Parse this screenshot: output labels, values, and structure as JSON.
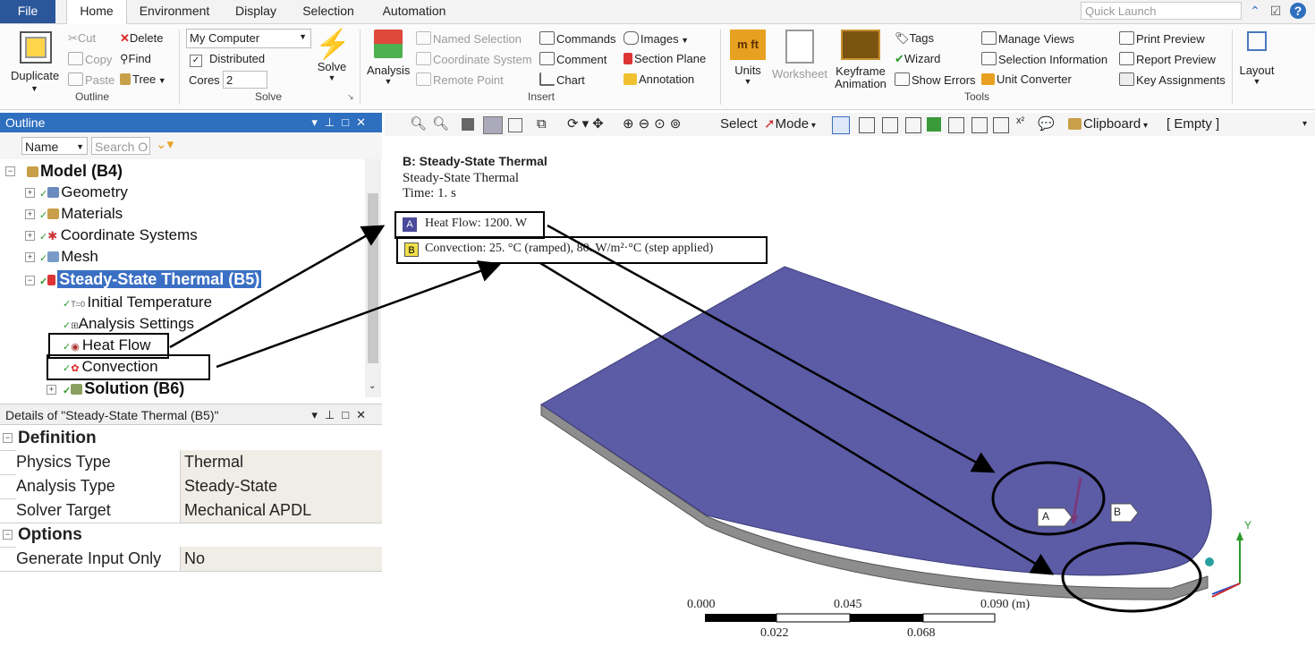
{
  "tabs": [
    "File",
    "Home",
    "Environment",
    "Display",
    "Selection",
    "Automation"
  ],
  "quick_launch": {
    "placeholder": "Quick Launch"
  },
  "ribbon": {
    "outline": {
      "label": "Outline",
      "duplicate": "Duplicate",
      "cut": "Cut",
      "copy": "Copy",
      "paste": "Paste",
      "delete": "Delete",
      "find": "Find",
      "tree": "Tree"
    },
    "solve": {
      "label": "Solve",
      "computer": "My Computer",
      "distributed": "Distributed",
      "cores_label": "Cores",
      "cores_value": "2",
      "solve_button": "Solve"
    },
    "insert": {
      "label": "Insert",
      "analysis": "Analysis",
      "named_selection": "Named Selection",
      "coordinate_system": "Coordinate System",
      "remote_point": "Remote Point",
      "commands": "Commands",
      "comment": "Comment",
      "chart": "Chart",
      "images": "Images",
      "section_plane": "Section Plane",
      "annotation": "Annotation"
    },
    "tools": {
      "label": "Tools",
      "units": "Units",
      "units_icon": "m ft",
      "worksheet": "Worksheet",
      "keyframe": "Keyframe",
      "animation": "Animation",
      "tags": "Tags",
      "wizard": "Wizard",
      "show_errors": "Show Errors",
      "manage_views": "Manage Views",
      "selection_information": "Selection Information",
      "unit_converter": "Unit Converter",
      "print_preview": "Print Preview",
      "report_preview": "Report Preview",
      "key_assignments": "Key Assignments"
    },
    "layout": "Layout"
  },
  "outline_panel": {
    "title": "Outline",
    "name_filter": "Name",
    "search_placeholder": "Search O",
    "items": [
      {
        "label": "Model (B4)"
      },
      {
        "label": "Geometry"
      },
      {
        "label": "Materials"
      },
      {
        "label": "Coordinate Systems"
      },
      {
        "label": "Mesh"
      },
      {
        "label": "Steady-State Thermal (B5)"
      },
      {
        "label": "Initial Temperature"
      },
      {
        "label": "Analysis Settings"
      },
      {
        "label": "Heat Flow"
      },
      {
        "label": "Convection"
      },
      {
        "label": "Solution (B6)"
      }
    ]
  },
  "details_panel": {
    "title": "Details of \"Steady-State Thermal (B5)\"",
    "sections": [
      {
        "title": "Definition",
        "rows": [
          {
            "name": "Physics Type",
            "value": "Thermal"
          },
          {
            "name": "Analysis Type",
            "value": "Steady-State"
          },
          {
            "name": "Solver Target",
            "value": "Mechanical APDL"
          }
        ]
      },
      {
        "title": "Options",
        "rows": [
          {
            "name": "Generate Input Only",
            "value": "No"
          }
        ]
      }
    ]
  },
  "graphics_toolbar": {
    "select": "Select",
    "mode": "Mode",
    "clipboard": "Clipboard",
    "empty": "[ Empty ]"
  },
  "viewport": {
    "header_title": "B: Steady-State Thermal",
    "header_subtitle": "Steady-State Thermal",
    "header_time": "Time: 1. s",
    "legend": [
      {
        "tag": "A",
        "text": "Heat Flow: 1200. W",
        "color": "#4a4a9a"
      },
      {
        "tag": "B",
        "text": "Convection: 25. °C  (ramped), 80. W/m²·°C  (step applied)",
        "color": "#f0e04a"
      }
    ],
    "plate_color": "#5b5ba6",
    "scale": {
      "top_labels": [
        "0.000",
        "0.045",
        "0.090 (m)"
      ],
      "bottom_labels": [
        "0.022",
        "0.068"
      ]
    },
    "marker_a": "A",
    "marker_b": "B",
    "axis_y": "Y"
  }
}
